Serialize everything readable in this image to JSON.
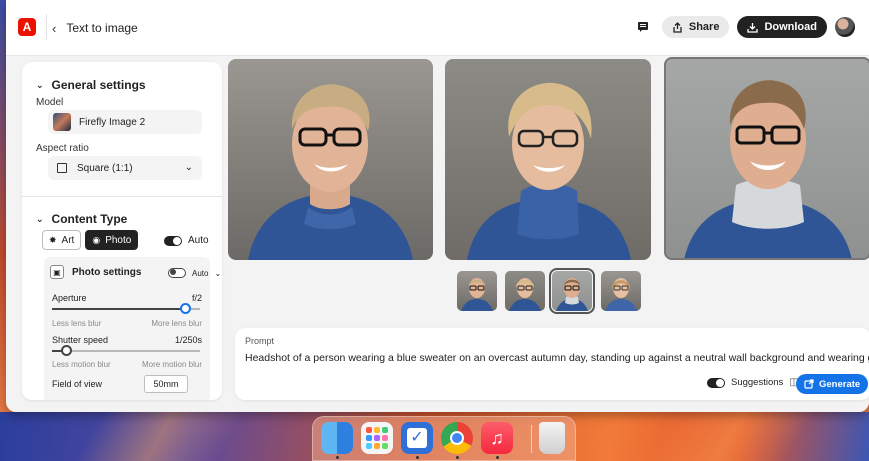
{
  "header": {
    "back_label": "Text to image",
    "share_label": "Share",
    "download_label": "Download"
  },
  "left_panel": {
    "general_settings": {
      "title": "General settings",
      "model_label": "Model",
      "model_value": "Firefly Image 2",
      "aspect_label": "Aspect ratio",
      "aspect_value": "Square (1:1)"
    },
    "content_type": {
      "title": "Content Type",
      "art_label": "Art",
      "photo_label": "Photo",
      "auto_label": "Auto",
      "auto_on": true
    },
    "photo_settings": {
      "title": "Photo settings",
      "auto_label": "Auto",
      "auto_on": false,
      "aperture_label": "Aperture",
      "aperture_value": "f/2",
      "aperture_level": 0.9,
      "aperture_min": "Less lens blur",
      "aperture_max": "More lens blur",
      "shutter_label": "Shutter speed",
      "shutter_value": "1/250s",
      "shutter_level": 0.1,
      "shutter_min": "Less motion blur",
      "shutter_max": "More motion blur",
      "fov_label": "Field of view",
      "fov_value": "50mm"
    }
  },
  "gallery": {
    "selected_index": 2,
    "thumbnails": [
      "portrait-1",
      "portrait-2",
      "portrait-3",
      "portrait-4"
    ]
  },
  "prompt": {
    "label": "Prompt",
    "text": "Headshot of a person wearing a blue sweater on an overcast autumn day, standing up against a neutral wall background and wearing glasses",
    "suggestions_label": "Suggestions",
    "suggestions_on": true,
    "generate_label": "Generate"
  },
  "colors": {
    "accent": "#1473e6",
    "brand": "#eb1000"
  },
  "dock": {
    "apps": [
      "finder-icon",
      "launchpad-icon",
      "tasks-icon",
      "chrome-icon",
      "music-icon",
      "trash-icon"
    ]
  }
}
